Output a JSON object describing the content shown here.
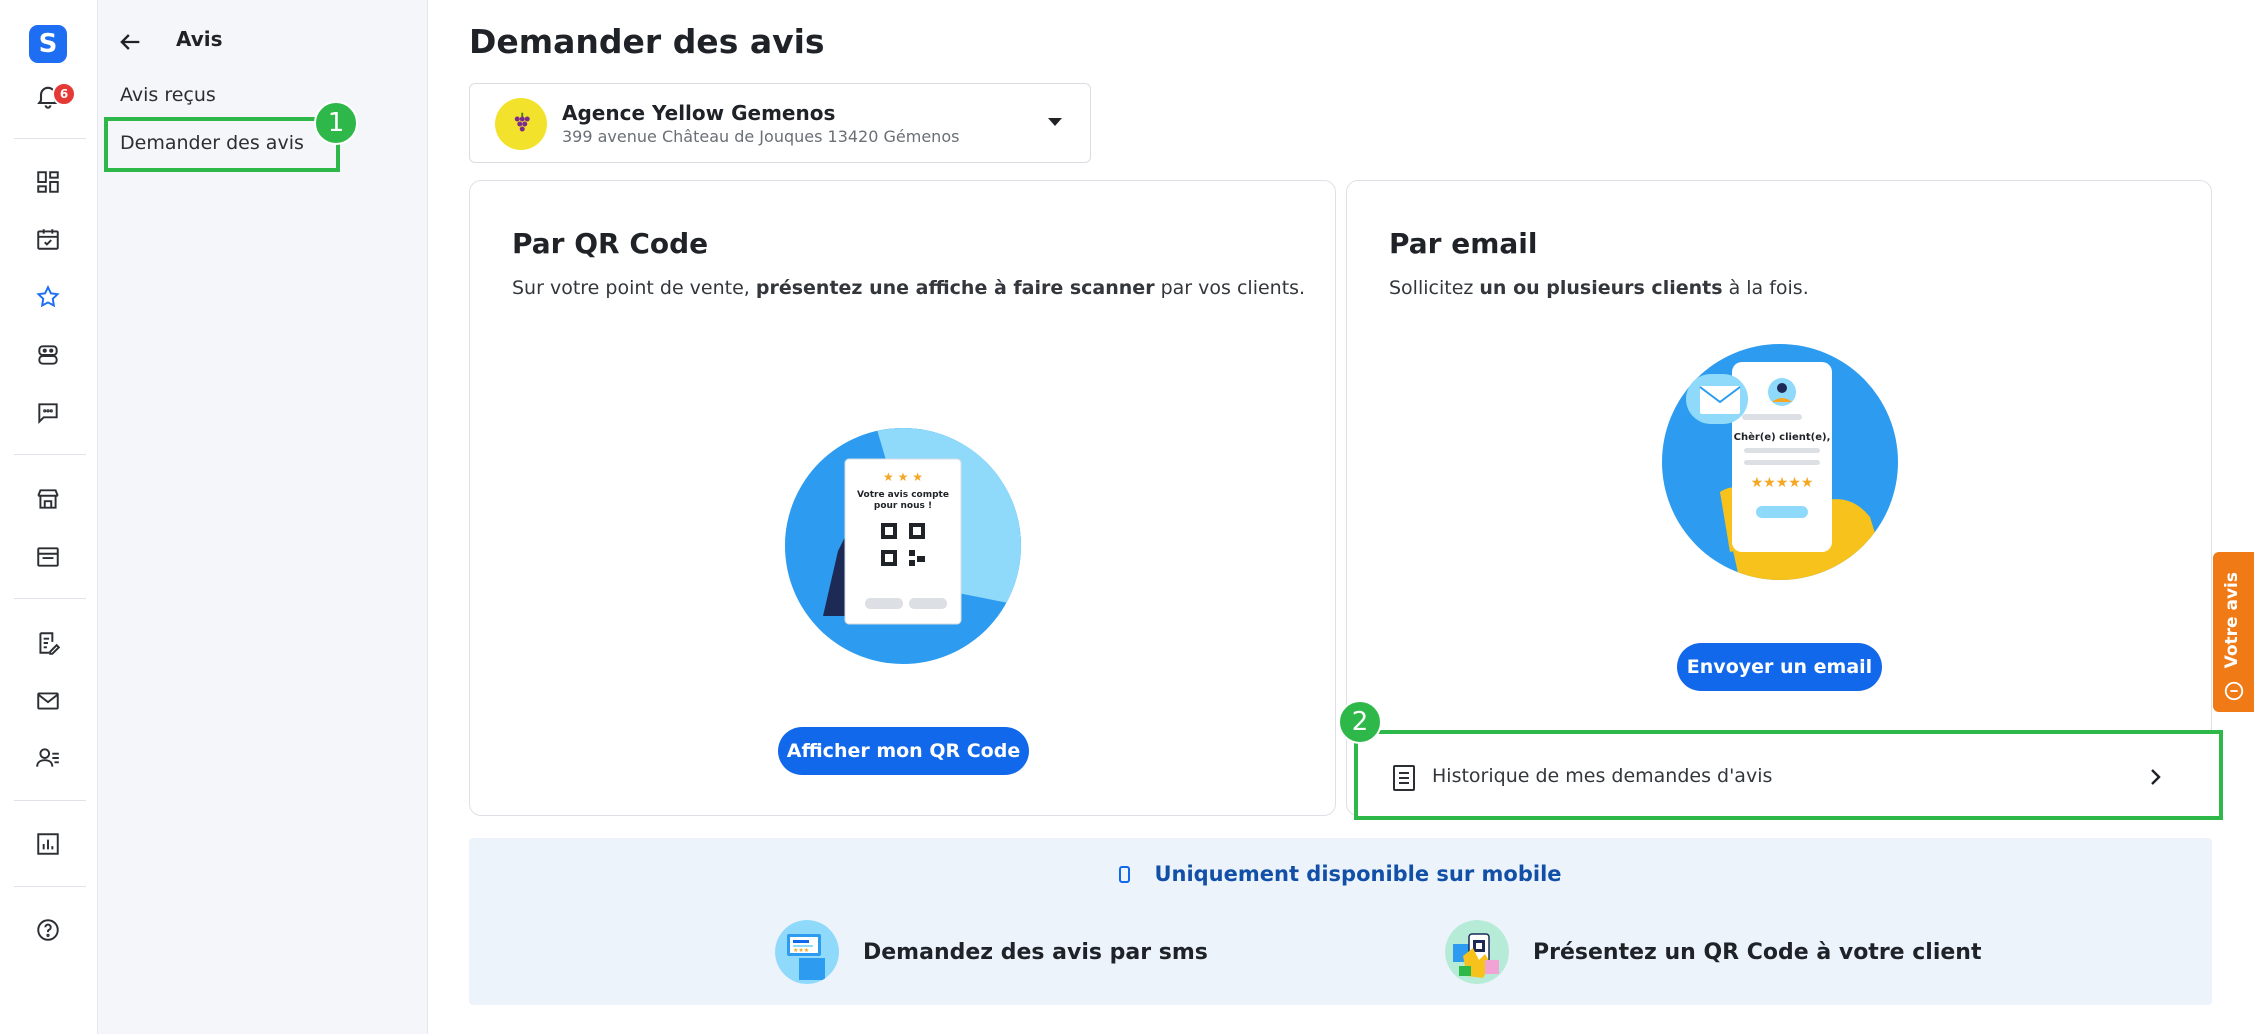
{
  "rail": {
    "logo": "S",
    "notifications_count": "6",
    "icons": [
      "dashboard-icon",
      "calendar-check-icon",
      "star-icon",
      "robot-icon",
      "chat-icon",
      "store-icon",
      "browser-icon",
      "edit-list-icon",
      "mail-icon",
      "contacts-icon",
      "chart-icon",
      "help-icon"
    ],
    "accent": "#1d6ef2"
  },
  "subnav": {
    "title": "Avis",
    "items": [
      {
        "label": "Avis reçus"
      },
      {
        "label": "Demander des avis"
      }
    ]
  },
  "annotations": {
    "first": "1",
    "second": "2",
    "color": "#2fb84a"
  },
  "main": {
    "title": "Demander des avis",
    "agency": {
      "name": "Agence Yellow Gemenos",
      "address": "399 avenue Château de Jouques 13420 Gémenos"
    },
    "qr_card": {
      "title": "Par QR Code",
      "desc_prefix": "Sur votre point de vente, ",
      "desc_bold": "présentez une affiche à faire scanner",
      "desc_suffix": " par vos clients.",
      "poster_text_line1": "Votre avis compte",
      "poster_text_line2": "pour nous !",
      "button": "Afficher mon QR Code"
    },
    "email_card": {
      "title": "Par email",
      "desc_prefix": "Sollicitez ",
      "desc_bold": "un ou plusieurs clients",
      "desc_suffix": " à la fois.",
      "phone_text": "Chèr(e) client(e),",
      "button": "Envoyer un email"
    },
    "history": {
      "label": "Historique de mes demandes d'avis"
    },
    "mobile": {
      "heading": "Uniquement disponible sur mobile",
      "option_sms": "Demandez des avis par sms",
      "option_qr": "Présentez un QR Code à votre client"
    }
  },
  "feedback_tab": {
    "label": "Votre avis",
    "color": "#f07a16"
  },
  "button_color": "#1268ea"
}
